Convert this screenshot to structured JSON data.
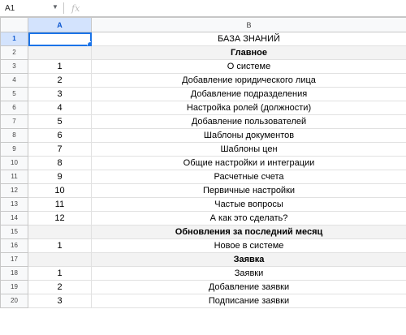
{
  "formula_bar": {
    "cell_ref": "A1",
    "fx_label": "fx"
  },
  "columns": [
    "A",
    "B"
  ],
  "rows": [
    {
      "num": "1",
      "a": "",
      "b": "БАЗА ЗНАНИЙ",
      "bold": false,
      "shade": false
    },
    {
      "num": "2",
      "a": "",
      "b": "Главное",
      "bold": true,
      "shade": true
    },
    {
      "num": "3",
      "a": "1",
      "b": "О системе",
      "bold": false,
      "shade": false
    },
    {
      "num": "4",
      "a": "2",
      "b": "Добавление юридического лица",
      "bold": false,
      "shade": false
    },
    {
      "num": "5",
      "a": "3",
      "b": "Добавление подразделения",
      "bold": false,
      "shade": false
    },
    {
      "num": "6",
      "a": "4",
      "b": "Настройка ролей (должности)",
      "bold": false,
      "shade": false
    },
    {
      "num": "7",
      "a": "5",
      "b": "Добавление пользователей",
      "bold": false,
      "shade": false
    },
    {
      "num": "8",
      "a": "6",
      "b": "Шаблоны документов",
      "bold": false,
      "shade": false
    },
    {
      "num": "9",
      "a": "7",
      "b": "Шаблоны цен",
      "bold": false,
      "shade": false
    },
    {
      "num": "10",
      "a": "8",
      "b": "Общие настройки и интеграции",
      "bold": false,
      "shade": false
    },
    {
      "num": "11",
      "a": "9",
      "b": "Расчетные счета",
      "bold": false,
      "shade": false
    },
    {
      "num": "12",
      "a": "10",
      "b": "Первичные настройки",
      "bold": false,
      "shade": false
    },
    {
      "num": "13",
      "a": "11",
      "b": "Частые вопросы",
      "bold": false,
      "shade": false
    },
    {
      "num": "14",
      "a": "12",
      "b": "А как это сделать?",
      "bold": false,
      "shade": false
    },
    {
      "num": "15",
      "a": "",
      "b": "Обновления за последний месяц",
      "bold": true,
      "shade": true
    },
    {
      "num": "16",
      "a": "1",
      "b": "Новое в системе",
      "bold": false,
      "shade": false
    },
    {
      "num": "17",
      "a": "",
      "b": "Заявка",
      "bold": true,
      "shade": true
    },
    {
      "num": "18",
      "a": "1",
      "b": "Заявки",
      "bold": false,
      "shade": false
    },
    {
      "num": "19",
      "a": "2",
      "b": "Добавление заявки",
      "bold": false,
      "shade": false
    },
    {
      "num": "20",
      "a": "3",
      "b": "Подписание заявки",
      "bold": false,
      "shade": false
    }
  ]
}
